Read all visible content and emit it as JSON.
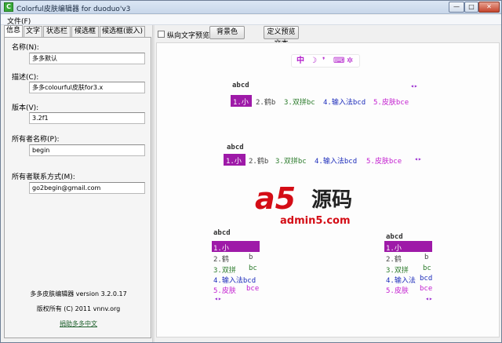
{
  "window": {
    "title": "Colorful皮肤编辑器 for duoduo'v3",
    "icon": "C",
    "minimize_icon": "—",
    "maximize_icon": "□",
    "close_icon": "✕"
  },
  "menu": {
    "file": "文件(F)"
  },
  "tabs": [
    "信息",
    "文字",
    "状态栏",
    "候选框",
    "候选框(嵌入)"
  ],
  "info": {
    "name_label": "名称(N):",
    "name_value": "多多默认",
    "desc_label": "描述(C):",
    "desc_value": "多多colourful皮肤for3.x",
    "version_label": "版本(V):",
    "version_value": "3.2f1",
    "owner_label": "所有者名称(P):",
    "owner_value": "begin",
    "contact_label": "所有者联系方式(M):",
    "contact_value": "go2begin@gmail.com"
  },
  "footer": {
    "app_version": "多多皮肤编辑器 version 3.2.0.17",
    "copyright": "版权所有 (C) 2011 vnnv.org",
    "donate": "捐助多多中文"
  },
  "toolbar": {
    "vertical_preview_label": "纵向文字预览",
    "vertical_preview_checked": false,
    "bg_button": "背景色",
    "preview_text_button": "定义预览文本"
  },
  "status_icons": [
    "中",
    "☽",
    "❜",
    "⌨",
    "✲"
  ],
  "accent_color": "#9e1aa8",
  "candidates": {
    "composition": "abcd",
    "arrows": "◂▸",
    "items": [
      {
        "index": "1.",
        "word": "小",
        "code": ""
      },
      {
        "index": "2.",
        "word": "鹤",
        "code": "b"
      },
      {
        "index": "3.",
        "word": "双拼",
        "code": "bc"
      },
      {
        "index": "4.",
        "word": "输入法",
        "code": "bcd"
      },
      {
        "index": "5.",
        "word": "皮肤",
        "code": "bce"
      }
    ]
  },
  "watermark": {
    "brand": "a5",
    "name": "源码",
    "domain": "admin5.com"
  }
}
